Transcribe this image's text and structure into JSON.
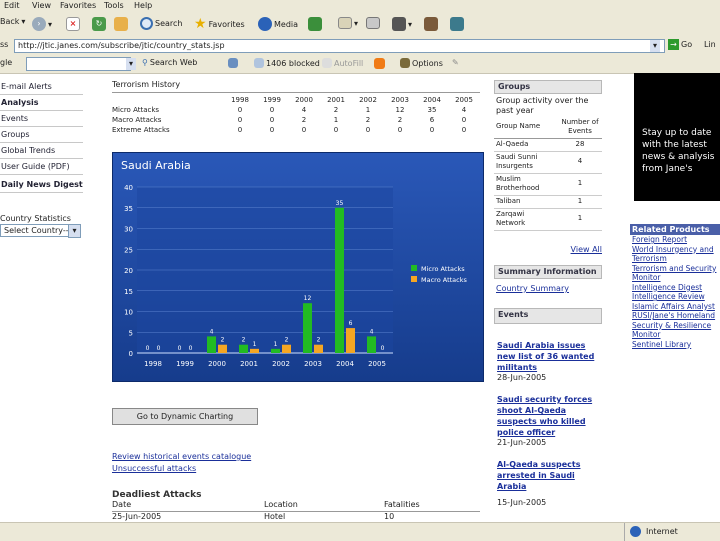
{
  "menu": [
    "Edit",
    "View",
    "Favorites",
    "Tools",
    "Help"
  ],
  "toolbar": {
    "back": "Back",
    "search": "Search",
    "favorites": "Favorites",
    "media": "Media"
  },
  "address": {
    "label": "ss",
    "url": "http://jtic.janes.com/subscribe/jtic/country_stats.jsp",
    "go": "Go",
    "links": "Lin"
  },
  "google": {
    "label": "gle",
    "search_web": "Search Web",
    "blocked": "1406 blocked",
    "autofill": "AutoFill",
    "options": "Options"
  },
  "sidebar": {
    "items": [
      "E-mail Alerts",
      "Analysis",
      "Events",
      "Groups",
      "Global Trends",
      "User Guide (PDF)",
      "Daily News Digest"
    ],
    "country_label": "Country Statistics",
    "country_select": "Select Country--"
  },
  "history": {
    "title": "Terrorism History",
    "years": [
      "1998",
      "1999",
      "2000",
      "2001",
      "2002",
      "2003",
      "2004",
      "2005"
    ],
    "rows": [
      {
        "label": "Micro Attacks",
        "values": [
          "0",
          "0",
          "4",
          "2",
          "1",
          "12",
          "35",
          "4"
        ]
      },
      {
        "label": "Macro Attacks",
        "values": [
          "0",
          "0",
          "2",
          "1",
          "2",
          "2",
          "6",
          "0"
        ]
      },
      {
        "label": "Extreme Attacks",
        "values": [
          "0",
          "0",
          "0",
          "0",
          "0",
          "0",
          "0",
          "0"
        ]
      }
    ]
  },
  "chart_data": {
    "type": "bar",
    "title": "Saudi Arabia",
    "categories": [
      "1998",
      "1999",
      "2000",
      "2001",
      "2002",
      "2003",
      "2004",
      "2005"
    ],
    "series": [
      {
        "name": "Micro Attacks",
        "color": "#22bb22",
        "values": [
          0,
          0,
          4,
          2,
          1,
          12,
          35,
          4
        ]
      },
      {
        "name": "Macro Attacks",
        "color": "#f5a623",
        "values": [
          0,
          0,
          2,
          1,
          2,
          2,
          6,
          0
        ]
      }
    ],
    "ylim": [
      0,
      40
    ],
    "yticks": [
      0,
      5,
      10,
      15,
      20,
      25,
      30,
      35,
      40
    ],
    "legend": "right"
  },
  "dynamic_button": "Go to Dynamic Charting",
  "links": {
    "review": "Review historical events catalogue",
    "unsuccessful": "Unsuccessful attacks"
  },
  "deadliest": {
    "title": "Deadliest Attacks",
    "headers": [
      "Date",
      "Location",
      "Fatalities"
    ],
    "first_row": [
      "25-Jun-2005",
      "Hotel",
      "10"
    ]
  },
  "groups": {
    "title": "Groups",
    "intro": "Group activity over the past year",
    "col1": "Group Name",
    "col2": "Number of Events",
    "rows": [
      {
        "name": "Al-Qaeda",
        "count": "28"
      },
      {
        "name": "Saudi Sunni Insurgents",
        "count": "4"
      },
      {
        "name": "Muslim Brotherhood",
        "count": "1"
      },
      {
        "name": "Taliban",
        "count": "1"
      },
      {
        "name": "Zarqawi Network",
        "count": "1"
      }
    ],
    "view_all": "View All"
  },
  "summary": {
    "title": "Summary Information",
    "link": "Country Summary"
  },
  "events": {
    "title": "Events",
    "items": [
      {
        "headline": "Saudi Arabia issues new list of 36 wanted militants",
        "date": "28-Jun-2005"
      },
      {
        "headline": "Saudi security forces shoot Al-Qaeda suspects who killed police officer",
        "date": "21-Jun-2005"
      },
      {
        "headline": "Al-Qaeda suspects arrested in Saudi Arabia",
        "date": "15-Jun-2005"
      }
    ]
  },
  "ad": {
    "text": "Stay up to date with the latest news & analysis from Jane's"
  },
  "related": {
    "title": "Related Products",
    "items": [
      "Foreign Report",
      "World Insurgency and Terrorism",
      "Terrorism and Security Monitor",
      "Intelligence Digest",
      "Intelligence Review",
      "Islamic Affairs Analyst",
      "RUSI/Jane's Homeland Security & Resilience Monitor",
      "Sentinel Library"
    ]
  },
  "status": {
    "zone": "Internet"
  }
}
